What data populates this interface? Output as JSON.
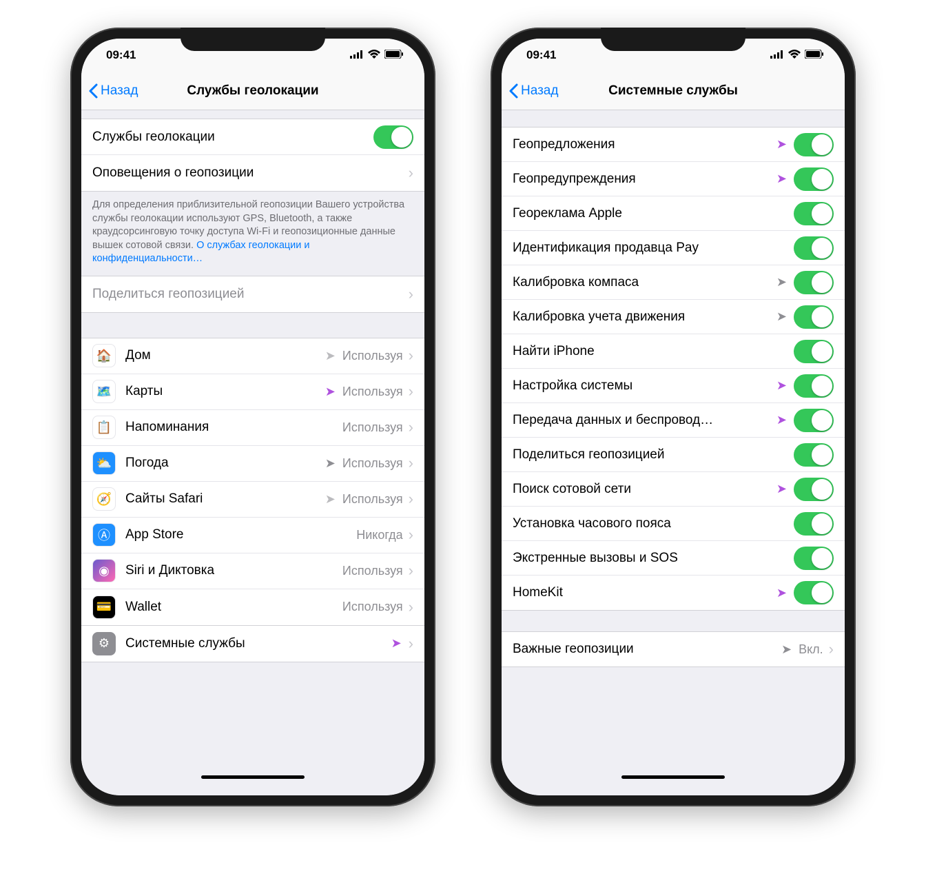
{
  "status": {
    "time": "09:41"
  },
  "left": {
    "back": "Назад",
    "title": "Службы геолокации",
    "services_label": "Службы геолокации",
    "alerts_label": "Оповещения о геопозиции",
    "footer_text": "Для определения приблизительной геопозиции Вашего устройства службы геолокации используют GPS, Bluetooth, а также краудсорсинговую точку доступа Wi-Fi и геопозиционные данные вышек сотовой связи. ",
    "footer_link": "О службах геолокации и конфиденциальности…",
    "share_label": "Поделиться геопозицией",
    "apps": [
      {
        "name": "Дом",
        "value": "Используя",
        "arrow": "outline",
        "icon_bg": "#fff",
        "icon_emoji": "🏠"
      },
      {
        "name": "Карты",
        "value": "Используя",
        "arrow": "purple",
        "icon_bg": "#fff",
        "icon_emoji": "🗺️"
      },
      {
        "name": "Напоминания",
        "value": "Используя",
        "arrow": "none",
        "icon_bg": "#fff",
        "icon_emoji": "📋"
      },
      {
        "name": "Погода",
        "value": "Используя",
        "arrow": "gray",
        "icon_bg": "#1e90ff",
        "icon_emoji": "⛅"
      },
      {
        "name": "Сайты Safari",
        "value": "Используя",
        "arrow": "outline",
        "icon_bg": "#fff",
        "icon_emoji": "🧭"
      },
      {
        "name": "App Store",
        "value": "Никогда",
        "arrow": "none",
        "icon_bg": "#1e90ff",
        "icon_emoji": "Ⓐ"
      },
      {
        "name": "Siri и Диктовка",
        "value": "Используя",
        "arrow": "none",
        "icon_bg": "linear-gradient(135deg,#6a5acd,#ff69b4)",
        "icon_emoji": "◉"
      },
      {
        "name": "Wallet",
        "value": "Используя",
        "arrow": "none",
        "icon_bg": "#000",
        "icon_emoji": "💳"
      }
    ],
    "system_label": "Системные службы"
  },
  "right": {
    "back": "Назад",
    "title": "Системные службы",
    "items": [
      {
        "name": "Геопредложения",
        "arrow": "purple",
        "toggle": true
      },
      {
        "name": "Геопредупреждения",
        "arrow": "purple",
        "toggle": true
      },
      {
        "name": "Геореклама Apple",
        "arrow": "none",
        "toggle": true
      },
      {
        "name": "Идентификация продавца Pay",
        "arrow": "none",
        "toggle": true
      },
      {
        "name": "Калибровка компаса",
        "arrow": "gray",
        "toggle": true
      },
      {
        "name": "Калибровка учета движения",
        "arrow": "gray",
        "toggle": true
      },
      {
        "name": "Найти iPhone",
        "arrow": "none",
        "toggle": true
      },
      {
        "name": "Настройка системы",
        "arrow": "purple",
        "toggle": true
      },
      {
        "name": "Передача данных и беспровод…",
        "arrow": "purple",
        "toggle": true
      },
      {
        "name": "Поделиться геопозицией",
        "arrow": "none",
        "toggle": true
      },
      {
        "name": "Поиск сотовой сети",
        "arrow": "purple",
        "toggle": true
      },
      {
        "name": "Установка часового пояса",
        "arrow": "none",
        "toggle": true
      },
      {
        "name": "Экстренные вызовы и SOS",
        "arrow": "none",
        "toggle": true
      },
      {
        "name": "HomeKit",
        "arrow": "purple",
        "toggle": true
      }
    ],
    "significant_label": "Важные геопозиции",
    "significant_value": "Вкл."
  }
}
